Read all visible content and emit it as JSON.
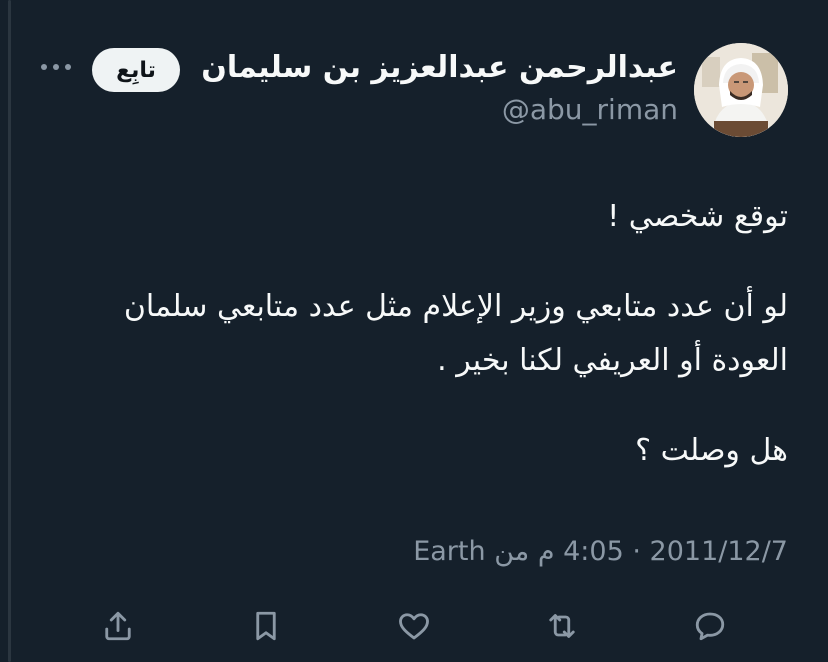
{
  "author": {
    "display_name": "عبدالرحمن عبدالعزيز بن سليمان",
    "handle": "@abu_riman"
  },
  "header": {
    "follow_label": "تابِع",
    "more_icon": "more-horizontal-icon"
  },
  "tweet": {
    "lines": [
      "توقع شخصي !",
      "لو أن عدد متابعي وزير الإعلام مثل عدد متابعي سلمان",
      "العودة أو العريفي لكنا بخير .",
      "هل وصلت ؟"
    ]
  },
  "meta": {
    "date": "2011/12/7",
    "separator": "·",
    "time": "4:05 م",
    "source": "من Earth"
  },
  "actions": [
    {
      "name": "reply",
      "icon": "reply-icon"
    },
    {
      "name": "retweet",
      "icon": "retweet-icon"
    },
    {
      "name": "like",
      "icon": "heart-icon"
    },
    {
      "name": "bookmark",
      "icon": "bookmark-icon"
    },
    {
      "name": "share",
      "icon": "share-icon"
    }
  ],
  "colors": {
    "background": "#15202b",
    "text": "#f7f9f9",
    "secondary_text": "#8b98a5",
    "follow_button_bg": "#eff3f4"
  }
}
